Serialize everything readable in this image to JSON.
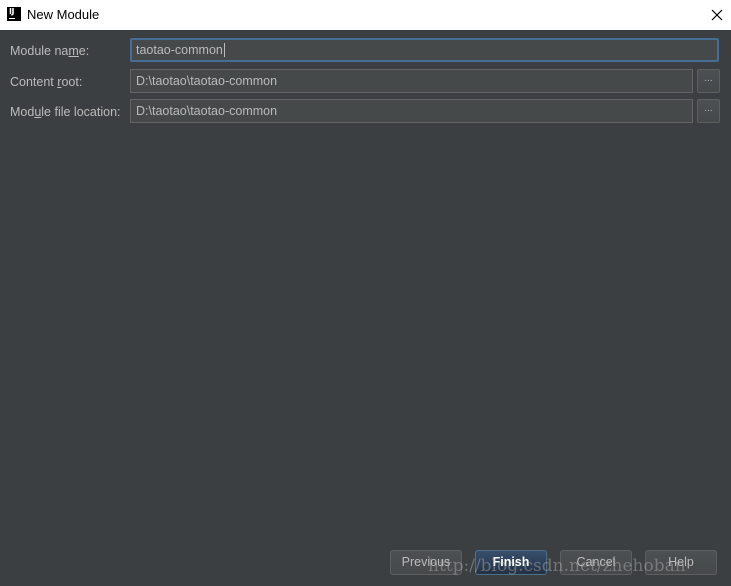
{
  "window": {
    "title": "New Module",
    "logo_text": "IJ"
  },
  "form": {
    "module_name": {
      "label_pre": "Module na",
      "label_mnemonic": "m",
      "label_post": "e:",
      "value": "taotao-common"
    },
    "content_root": {
      "label_pre": "Content ",
      "label_mnemonic": "r",
      "label_post": "oot:",
      "value": "D:\\taotao\\taotao-common",
      "browse_label": "..."
    },
    "module_file_location": {
      "label_pre": "Mod",
      "label_mnemonic": "u",
      "label_post": "le file location:",
      "value": "D:\\taotao\\taotao-common",
      "browse_label": "..."
    }
  },
  "buttons": {
    "previous": "Previous",
    "finish": "Finish",
    "cancel": "Cancel",
    "help": "Help"
  },
  "watermark": "http://blog.csdn.net/zhehoban",
  "colors": {
    "background": "#3c3f41",
    "titlebar": "#ffffff",
    "text": "#bbbbbb",
    "field_bg": "#45494a",
    "focus_border": "#466d94",
    "default_button": "#2f4157"
  }
}
